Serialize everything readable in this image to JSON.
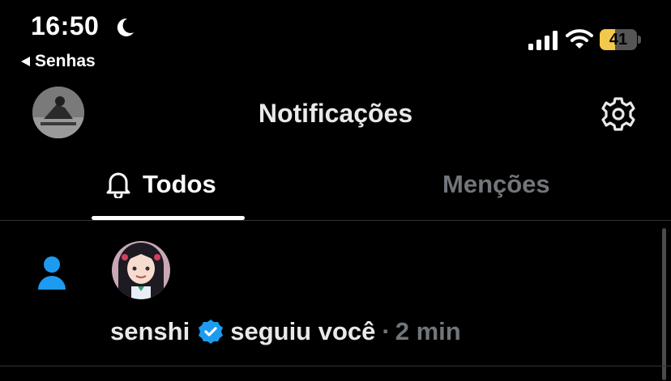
{
  "status_bar": {
    "time": "16:50",
    "back_label": "Senhas",
    "battery_percent": "41",
    "battery_level": 0.41,
    "battery_color": "#f2c94c"
  },
  "header": {
    "title": "Notificações"
  },
  "tabs": [
    {
      "label": "Todos",
      "active": true,
      "icon": "bell-icon"
    },
    {
      "label": "Menções",
      "active": false
    }
  ],
  "notifications": [
    {
      "type_icon": "person-icon",
      "user": "senshi",
      "verified": true,
      "action": "seguiu você",
      "separator": "·",
      "time": "2 min"
    }
  ],
  "colors": {
    "accent": "#1d9bf0",
    "text": "#e7e9ea",
    "muted": "#71767b",
    "background": "#000000"
  }
}
